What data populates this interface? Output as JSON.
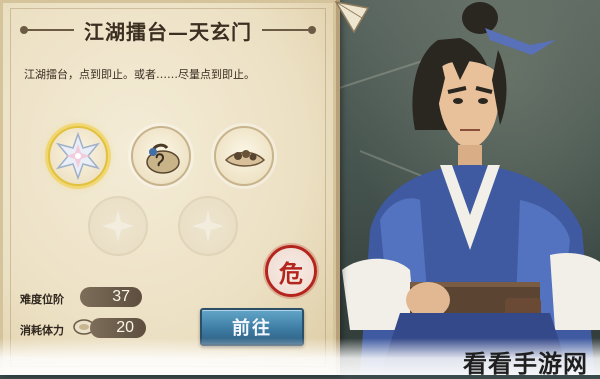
{
  "panel": {
    "title": "江湖擂台—天玄门",
    "description": "江湖擂台，点到即止。或者……尽量点到即止。"
  },
  "rewards": [
    {
      "name": "star-crystal-icon",
      "state": "highlighted"
    },
    {
      "name": "pouch-icon",
      "state": "normal"
    },
    {
      "name": "food-bowl-icon",
      "state": "normal"
    },
    {
      "name": "empty-slot-icon",
      "state": "empty"
    },
    {
      "name": "empty-slot-icon",
      "state": "empty"
    }
  ],
  "stats": {
    "difficulty_label": "难度位阶",
    "difficulty_value": "37",
    "stamina_label": "消耗体力",
    "stamina_value": "20"
  },
  "danger_badge": "危",
  "go_button": "前往",
  "watermark": "看看手游网",
  "colors": {
    "parchment": "#ece0c3",
    "seal_red": "#b4261d",
    "button_blue": "#3e7ca3",
    "robe_blue": "#3f5aa0"
  }
}
